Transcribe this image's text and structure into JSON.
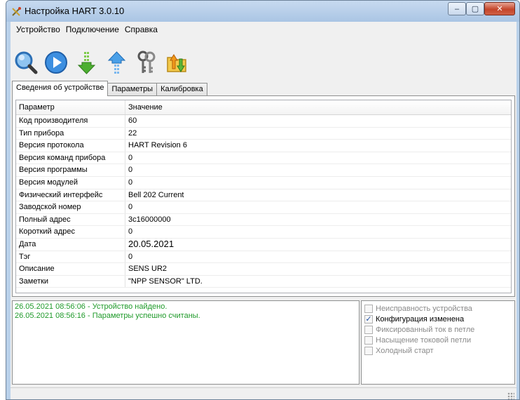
{
  "window": {
    "title": "Настройка HART 3.0.10",
    "controls": {
      "minimize": "–",
      "maximize": "▢",
      "close": "✕"
    }
  },
  "menu": [
    "Устройство",
    "Подключение",
    "Справка"
  ],
  "toolbar": [
    {
      "icon": "search-icon"
    },
    {
      "icon": "play-icon"
    },
    {
      "icon": "download-arrow-icon"
    },
    {
      "icon": "upload-arrow-icon"
    },
    {
      "icon": "keys-icon"
    },
    {
      "icon": "folder-sync-icon"
    }
  ],
  "tabs": [
    "Сведения об устройстве",
    "Параметры",
    "Калибровка"
  ],
  "table": {
    "headers": [
      "Параметр",
      "Значение"
    ],
    "rows": [
      [
        "Код производителя",
        "60"
      ],
      [
        "Тип прибора",
        "22"
      ],
      [
        "Версия протокола",
        "HART Revision 6"
      ],
      [
        "Версия команд прибора",
        "0"
      ],
      [
        "Версия программы",
        "0"
      ],
      [
        "Версия модулей",
        "0"
      ],
      [
        "Физический интерфейс",
        "Bell 202 Current"
      ],
      [
        "Заводской номер",
        "0"
      ],
      [
        "Полный адрес",
        "3c16000000"
      ],
      [
        "Короткий адрес",
        "0"
      ],
      [
        "Дата",
        "20.05.2021"
      ],
      [
        "Тэг",
        "0"
      ],
      [
        "Описание",
        "SENS UR2"
      ],
      [
        "Заметки",
        "\"NPP SENSOR\" LTD."
      ]
    ]
  },
  "log": [
    "26.05.2021 08:56:06 - Устройство найдено.",
    "26.05.2021 08:56:16 - Параметры успешно считаны."
  ],
  "flags": [
    {
      "label": "Неисправность устройства",
      "checked": false,
      "active": false
    },
    {
      "label": "Конфигурация изменена",
      "checked": true,
      "active": true
    },
    {
      "label": "Фиксированный ток в петле",
      "checked": false,
      "active": false
    },
    {
      "label": "Насыщение токовой петли",
      "checked": false,
      "active": false
    },
    {
      "label": "Холодный старт",
      "checked": false,
      "active": false
    }
  ],
  "colors": {
    "log_text": "#1f9a2a",
    "titlebar": "#b9d1ea",
    "close_button": "#c4452a"
  }
}
